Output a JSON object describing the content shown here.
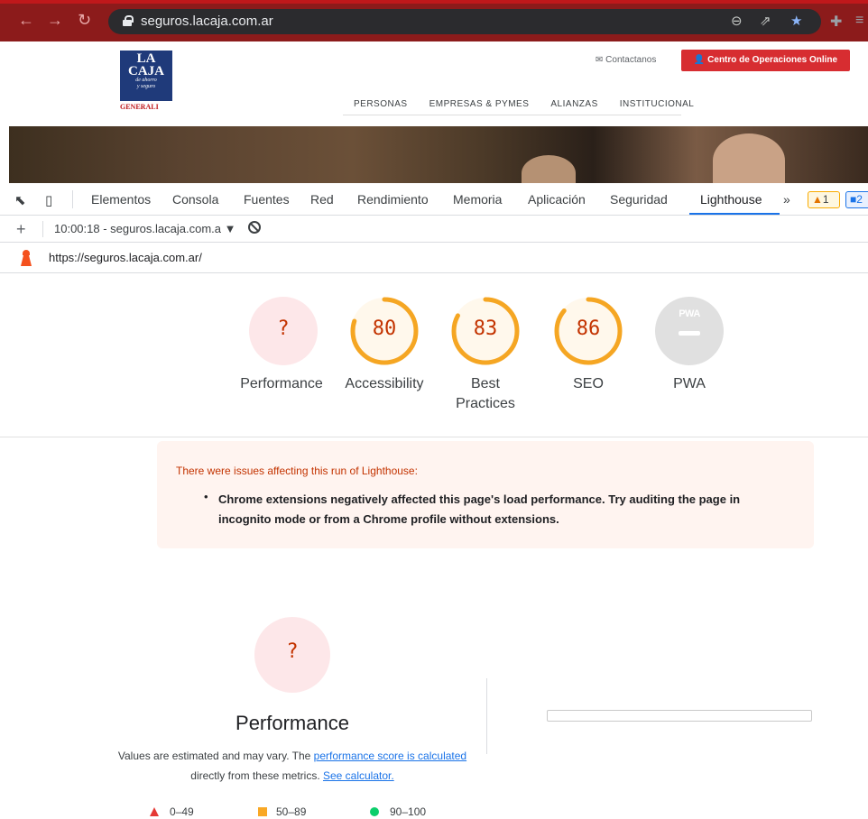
{
  "browser": {
    "url": "seguros.lacaja.com.ar"
  },
  "site": {
    "logo": {
      "line1": "LA",
      "line2": "CAJA",
      "line3": "de ahorro",
      "line4": "y seguro",
      "brand": "GENERALI"
    },
    "contact": "Contactanos",
    "cta": "Centro de Operaciones Online",
    "nav": [
      "PERSONAS",
      "EMPRESAS & PYMES",
      "ALIANZAS",
      "INSTITUCIONAL"
    ]
  },
  "devtools": {
    "tabs": [
      "Elementos",
      "Consola",
      "Fuentes",
      "Red",
      "Rendimiento",
      "Memoria",
      "Aplicación",
      "Seguridad",
      "Lighthouse"
    ],
    "more": "»",
    "warn_count": "1",
    "info_count": "2",
    "run_label": "10:00:18 - seguros.lacaja.com.a",
    "report_url": "https://seguros.lacaja.com.ar/"
  },
  "scores": [
    {
      "label": "Performance",
      "value": "?",
      "score": null
    },
    {
      "label": "Accessibility",
      "value": "80",
      "score": 80
    },
    {
      "label": "Best Practices",
      "value": "83",
      "score": 83
    },
    {
      "label": "SEO",
      "value": "86",
      "score": 86
    },
    {
      "label": "PWA",
      "value": "PWA",
      "score": null
    }
  ],
  "warning": {
    "heading": "There were issues affecting this run of Lighthouse:",
    "item": "Chrome extensions negatively affected this page's load performance. Try auditing the page in incognito mode or from a Chrome profile without extensions."
  },
  "performance": {
    "score": "?",
    "title": "Performance",
    "desc_prefix": "Values are estimated and may vary. The ",
    "link1": "performance score is calculated",
    "desc_mid": " directly from these metrics. ",
    "link2": "See calculator."
  },
  "legend": [
    "0–49",
    "50–89",
    "90–100"
  ],
  "colors": {
    "average": "#ffa400",
    "fail_bg": "#fde7e9",
    "fail_text": "#c33300",
    "link": "#1a73e8"
  }
}
